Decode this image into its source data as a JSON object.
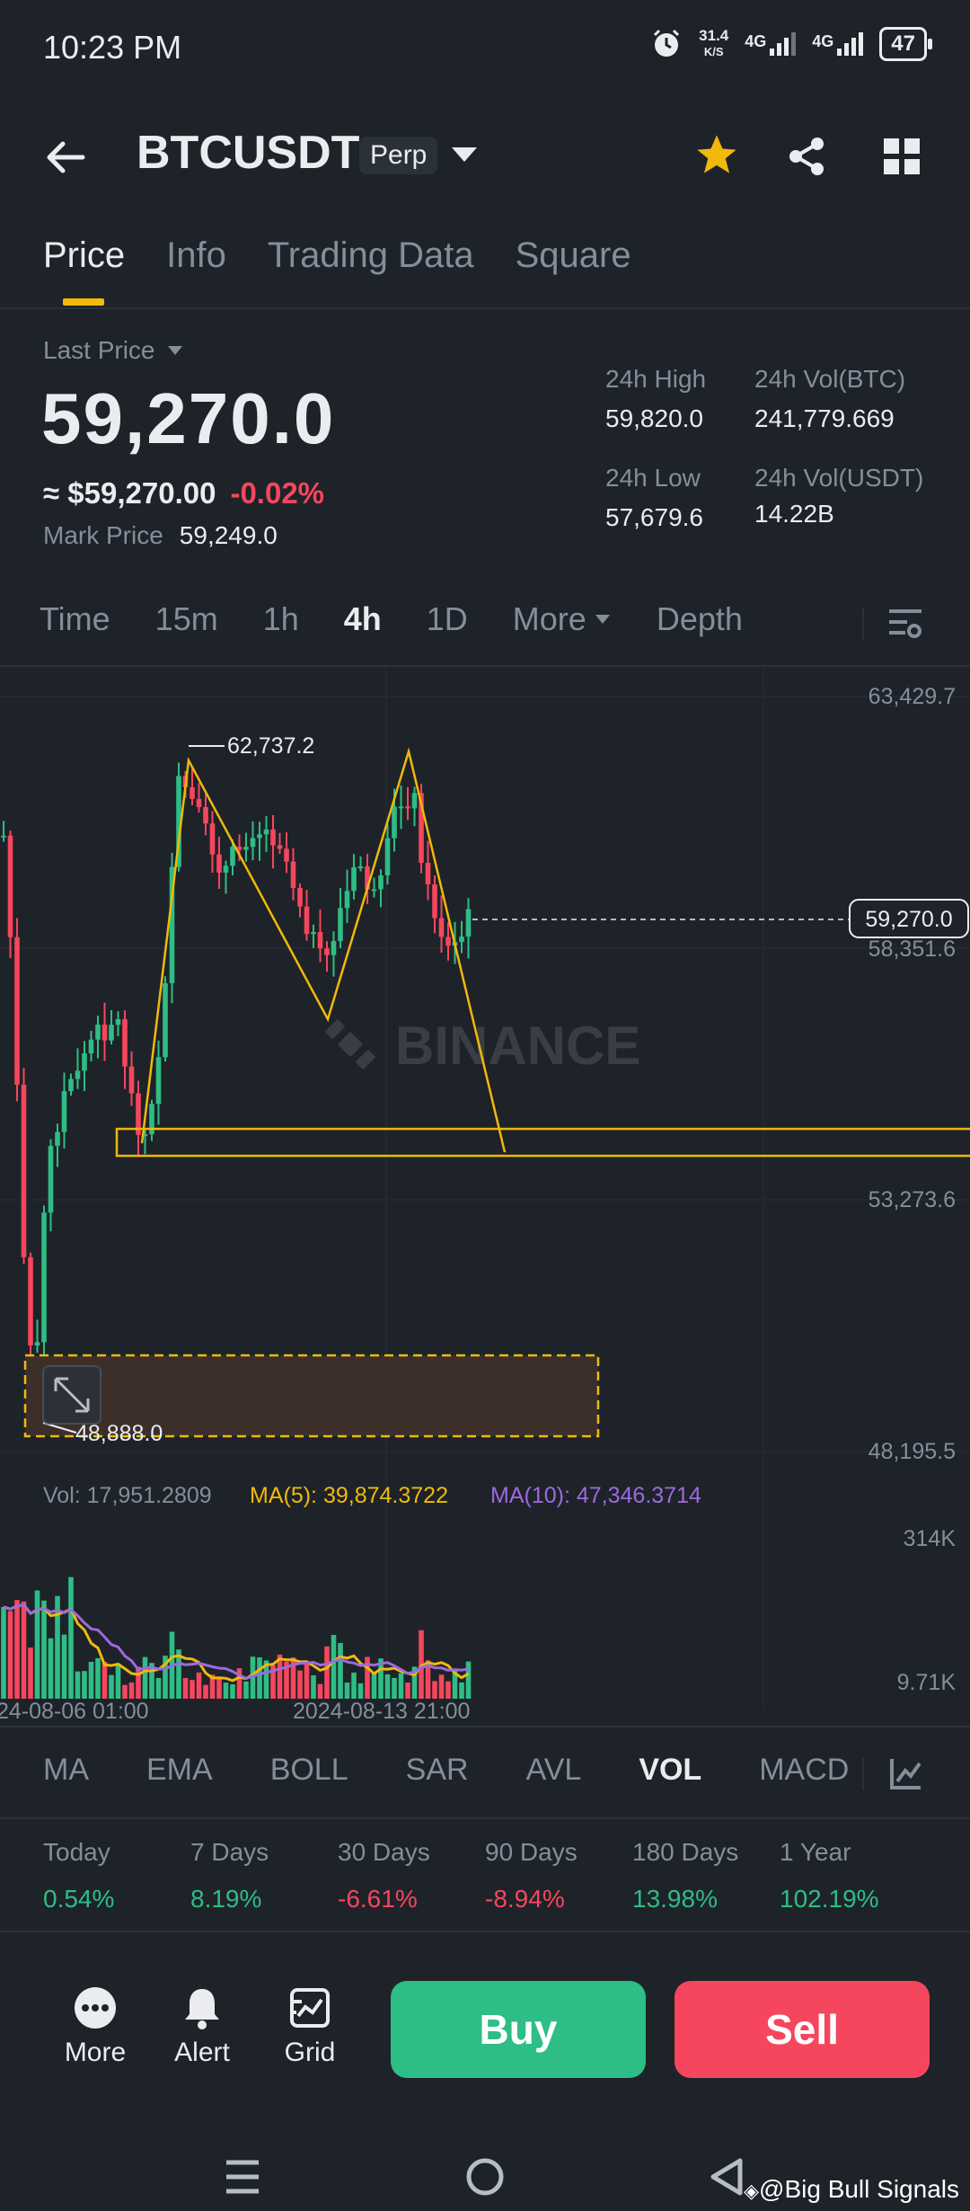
{
  "status_bar": {
    "time": "10:23 PM",
    "net_speed_value": "31.4",
    "net_speed_unit": "K/S",
    "signal1_label": "4G",
    "signal2_label": "4G",
    "battery": "47"
  },
  "header": {
    "symbol": "BTCUSDT",
    "contract_type": "Perp",
    "icons": [
      "back-arrow-icon",
      "chevron-down-icon",
      "star-icon",
      "share-icon",
      "grid-icon"
    ]
  },
  "tabs": [
    {
      "label": "Price",
      "active": true
    },
    {
      "label": "Info",
      "active": false
    },
    {
      "label": "Trading Data",
      "active": false
    },
    {
      "label": "Square",
      "active": false
    }
  ],
  "price_info": {
    "last_price_label": "Last Price",
    "last_price": "59,270.0",
    "usd_equiv": "≈ $59,270.00",
    "change_pct": "-0.02%",
    "mark_price_label": "Mark Price",
    "mark_price": "59,249.0"
  },
  "stats_24h": {
    "high_label": "24h High",
    "high": "59,820.0",
    "low_label": "24h Low",
    "low": "57,679.6",
    "vol_btc_label": "24h Vol(BTC)",
    "vol_btc": "241,779.669",
    "vol_usdt_label": "24h Vol(USDT)",
    "vol_usdt": "14.22B"
  },
  "timeframes": {
    "items": [
      "Time",
      "15m",
      "1h",
      "4h",
      "1D"
    ],
    "active": "4h",
    "more_label": "More",
    "depth_label": "Depth"
  },
  "chart": {
    "watermark": "BINANCE",
    "price_axis": [
      "63,429.7",
      "58,351.6",
      "53,273.6",
      "48,195.5"
    ],
    "current_price_tag": "59,270.0",
    "high_annotation": "62,737.2",
    "low_annotation": "48,888.0",
    "date_labels": [
      "24-08-06 01:00",
      "2024-08-13 21:00"
    ],
    "volume_legend": {
      "vol": "Vol: 17,951.2809",
      "ma5": "MA(5): 39,874.3722",
      "ma10": "MA(10): 47,346.3714"
    },
    "volume_axis": [
      "314K",
      "9.71K"
    ],
    "colors": {
      "up": "#2ebd85",
      "down": "#f6465d",
      "ma5": "#f0b90b",
      "ma10": "#9c6ade",
      "drawing": "#f0b90b"
    }
  },
  "indicators": {
    "items": [
      "MA",
      "EMA",
      "BOLL",
      "SAR",
      "AVL",
      "VOL",
      "MACD"
    ],
    "active": "VOL"
  },
  "performance": [
    {
      "label": "Today",
      "value": "0.54%",
      "dir": "up"
    },
    {
      "label": "7 Days",
      "value": "8.19%",
      "dir": "up"
    },
    {
      "label": "30 Days",
      "value": "-6.61%",
      "dir": "down"
    },
    {
      "label": "90 Days",
      "value": "-8.94%",
      "dir": "down"
    },
    {
      "label": "180 Days",
      "value": "13.98%",
      "dir": "up"
    },
    {
      "label": "1 Year",
      "value": "102.19%",
      "dir": "up"
    }
  ],
  "bottom_actions": {
    "more_label": "More",
    "alert_label": "Alert",
    "grid_label": "Grid",
    "buy_label": "Buy",
    "sell_label": "Sell",
    "buy_color": "#2ebd85",
    "sell_color": "#f6465d"
  },
  "watermark_text": "@Big Bull Signals"
}
